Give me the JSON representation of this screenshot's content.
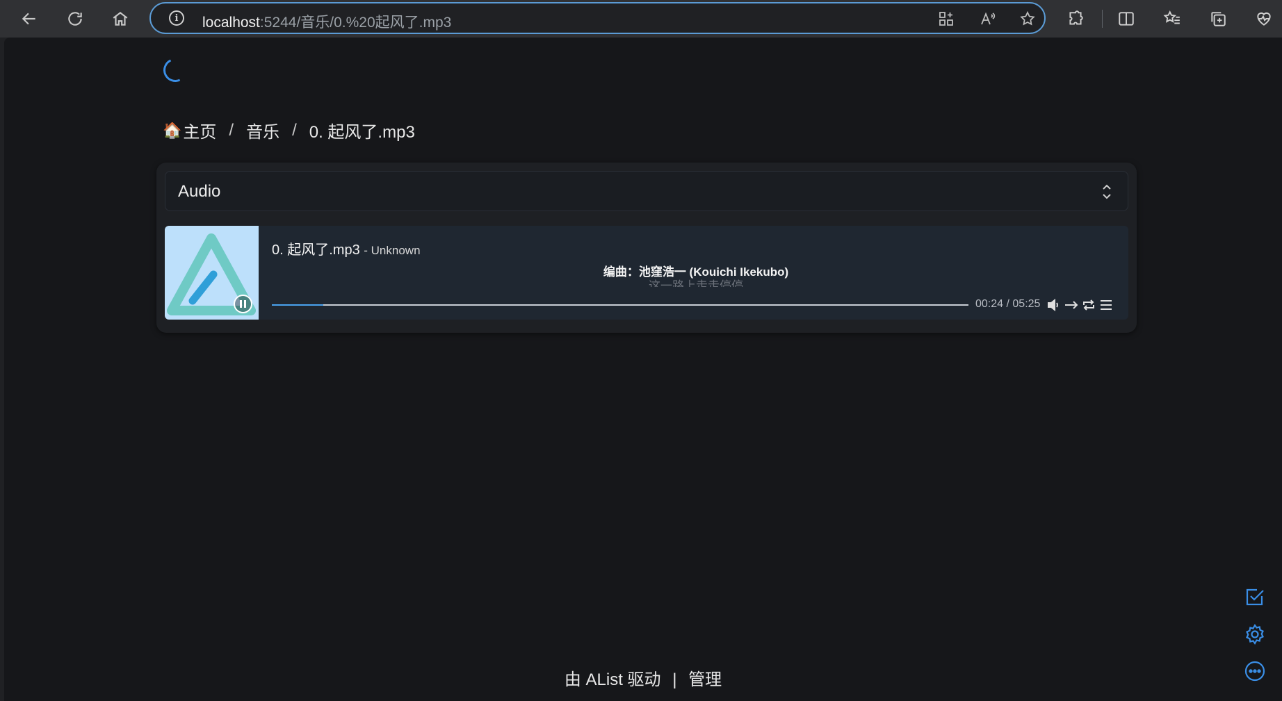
{
  "browser": {
    "url_host": "localhost",
    "url_rest": ":5244/音乐/0.%20起风了.mp3",
    "icons": {
      "back": "arrow-left-icon",
      "reload": "reload-icon",
      "home": "home-icon",
      "site_info": "info-icon",
      "app_available": "grid-plus-icon",
      "read_aloud": "read-aloud-icon",
      "favorite": "star-icon",
      "extensions": "puzzle-icon",
      "split_screen": "split-screen-icon",
      "favorites": "favorites-list-icon",
      "collections": "collections-icon",
      "performance": "heart-pulse-icon"
    },
    "accent": "#5b9bd5"
  },
  "breadcrumb": {
    "home_emoji": "🏠",
    "home": "主页",
    "separator": "/",
    "folder": "音乐",
    "file": "0. 起风了.mp3"
  },
  "preview_select": {
    "value": "Audio"
  },
  "player": {
    "title": "0. 起风了.mp3",
    "artist": "- Unknown",
    "lyric_current": "编曲：池窪浩一 (Kouichi Ikekubo)",
    "lyric_next": "这一路上走走停停",
    "time_current": "00:24",
    "time_separator": " / ",
    "time_total": "05:25",
    "progress_fraction": 0.074,
    "progress_color": "#4aa3f0",
    "cover_bg": "#bde0fb",
    "state": "playing"
  },
  "footer": {
    "powered_by": "由 AList 驱动",
    "divider": "|",
    "manage": "管理"
  },
  "floating": {
    "icons": [
      "checkbox-icon",
      "settings-gear-icon",
      "more-dots-icon"
    ],
    "color": "#3a8ee6"
  }
}
